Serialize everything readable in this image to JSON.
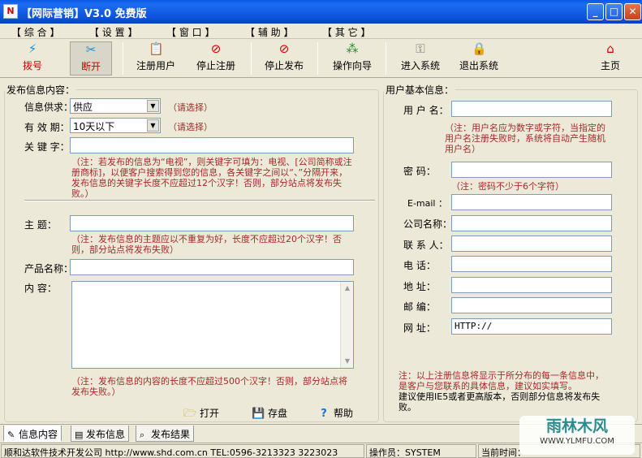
{
  "window": {
    "title": "【网际营销】V3.0 免费版",
    "app_icon": "N"
  },
  "menu": [
    "【 综  合 】",
    "【 设  置 】",
    "【 窗  口 】",
    "【 辅  助 】",
    "【 其  它 】"
  ],
  "toolbar": {
    "dial": "拨号",
    "hangup": "断开",
    "register": "注册用户",
    "stop_register": "停止注册",
    "stop_publish": "停止发布",
    "wizard": "操作向导",
    "enter": "进入系统",
    "exit": "退出系统",
    "home": "主页"
  },
  "publish": {
    "legend": "发布信息内容：",
    "info_type_label": "信息供求：",
    "info_type_value": "供应",
    "info_type_hint": "（请选择）",
    "validity_label": "有 效 期：",
    "validity_value": "10天以下",
    "validity_hint": "（请选择）",
    "keyword_label": "关 键 字：",
    "keyword_value": "",
    "keyword_note": "（注：若发布的信息为“电视”，则关键字可填为：电视、[公司简称或注册商标]，以便客户搜索得到您的信息，各关键字之间以“、”分隔开来，发布信息的关键字长度不应超过12个汉字！否则，部分站点将发布失败。）",
    "subject_label": "主    题：",
    "subject_value": "",
    "subject_note": "（注：发布信息的主题应以不重复为好，长度不应超过20个汉字！否则，部分站点将发布失败）",
    "product_label": "产品名称：",
    "product_value": "",
    "content_label": "内    容：",
    "content_value": "",
    "content_note": "（注：发布信息的内容的长度不应超过500个汉字！否则，部分站点将发布失败。）",
    "open": "打开",
    "save": "存盘",
    "help": "帮助"
  },
  "user": {
    "legend": "用户基本信息：",
    "username_label": "用 户 名：",
    "username_value": "",
    "username_note": "（注：用户名应为数字或字符，当指定的用户名注册失败时，系统将自动产生随机用户名）",
    "password_label": "密    码：",
    "password_value": "",
    "password_note": "（注：密码不少于6个字符）",
    "email_label": "E-mail ：",
    "email_value": "",
    "company_label": "公司名称：",
    "company_value": "",
    "contact_label": "联 系 人：",
    "contact_value": "",
    "phone_label": "电    话：",
    "phone_value": "",
    "address_label": "地    址：",
    "address_value": "",
    "zip_label": "邮    编：",
    "zip_value": "",
    "website_label": "网    址：",
    "website_value": "HTTP://",
    "note1": "注：以上注册信息将显示于所分布的每一条信息中，是客户与您联系的具体信息，建议如实填写。",
    "note2": "建议使用IE5或者更高版本，否则部分信息将发布失败。"
  },
  "tabs": [
    "信息内容",
    "发布信息",
    "发布结果"
  ],
  "status": {
    "company": "顺和达软件技术开发公司 http://www.shd.com.cn TEL:0596-3213323 3223023",
    "operator": "操作员：SYSTEM",
    "time": "当前时间："
  },
  "watermark": {
    "text1": "雨林木风",
    "text2": "WWW.YLMFU.COM"
  }
}
